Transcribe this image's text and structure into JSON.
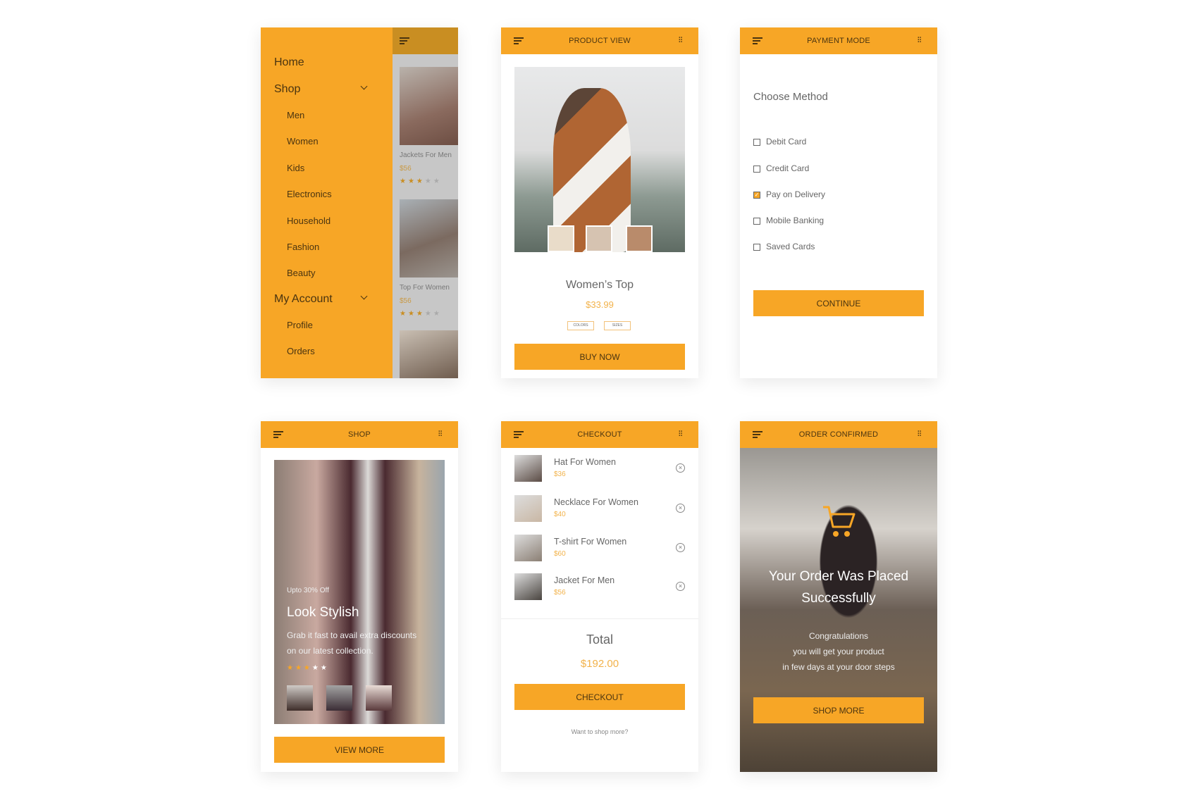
{
  "colors": {
    "accent": "#f7a626",
    "text_on_accent": "#4a3410",
    "price": "#f2b24a"
  },
  "menu_screen": {
    "items": [
      {
        "label": "Home",
        "level": 0
      },
      {
        "label": "Shop",
        "level": 0,
        "expandable": true
      },
      {
        "label": "Men",
        "level": 1
      },
      {
        "label": "Women",
        "level": 1
      },
      {
        "label": "Kids",
        "level": 1
      },
      {
        "label": "Electronics",
        "level": 1
      },
      {
        "label": "Household",
        "level": 1
      },
      {
        "label": "Fashion",
        "level": 1
      },
      {
        "label": "Beauty",
        "level": 1
      },
      {
        "label": "My Account",
        "level": 0,
        "expandable": true
      },
      {
        "label": "Profile",
        "level": 1
      },
      {
        "label": "Orders",
        "level": 1
      }
    ],
    "products": [
      {
        "name": "Jackets For Men",
        "price": "$56",
        "rating": 3
      },
      {
        "name": "Top For Women",
        "price": "$56",
        "rating": 3
      }
    ]
  },
  "product_view": {
    "title": "PRODUCT VIEW",
    "name": "Women’s Top",
    "price": "$33.99",
    "colors_label": "COLORS",
    "sizes_label": "SIZES",
    "buy_label": "BUY NOW"
  },
  "payment": {
    "title": "PAYMENT MODE",
    "heading": "Choose Method",
    "options": [
      {
        "label": "Debit Card",
        "checked": false
      },
      {
        "label": "Credit Card",
        "checked": false
      },
      {
        "label": "Pay on Delivery",
        "checked": true
      },
      {
        "label": "Mobile Banking",
        "checked": false
      },
      {
        "label": "Saved Cards",
        "checked": false
      }
    ],
    "continue_label": "CONTINUE"
  },
  "shop": {
    "title": "SHOP",
    "offer": "Upto 30% Off",
    "headline": "Look Stylish",
    "desc_line1": "Grab it fast to avail extra discounts",
    "desc_line2": "on our latest collection.",
    "rating": 3,
    "view_more_label": "VIEW MORE"
  },
  "checkout": {
    "title": "CHECKOUT",
    "items": [
      {
        "name": "Hat For Women",
        "price": "$36"
      },
      {
        "name": "Necklace For Women",
        "price": "$40"
      },
      {
        "name": "T-shirt For Women",
        "price": "$60"
      },
      {
        "name": "Jacket For Men",
        "price": "$56"
      }
    ],
    "total_label": "Total",
    "total": "$192.00",
    "checkout_label": "CHECKOUT",
    "shop_more_link": "Want to shop more?"
  },
  "confirmed": {
    "title": "ORDER CONFIRMED",
    "line1": "Your Order Was Placed",
    "line2": "Successfully",
    "msg1": "Congratulations",
    "msg2": "you will get your product",
    "msg3": "in few days at your door steps",
    "button_label": "SHOP MORE"
  }
}
